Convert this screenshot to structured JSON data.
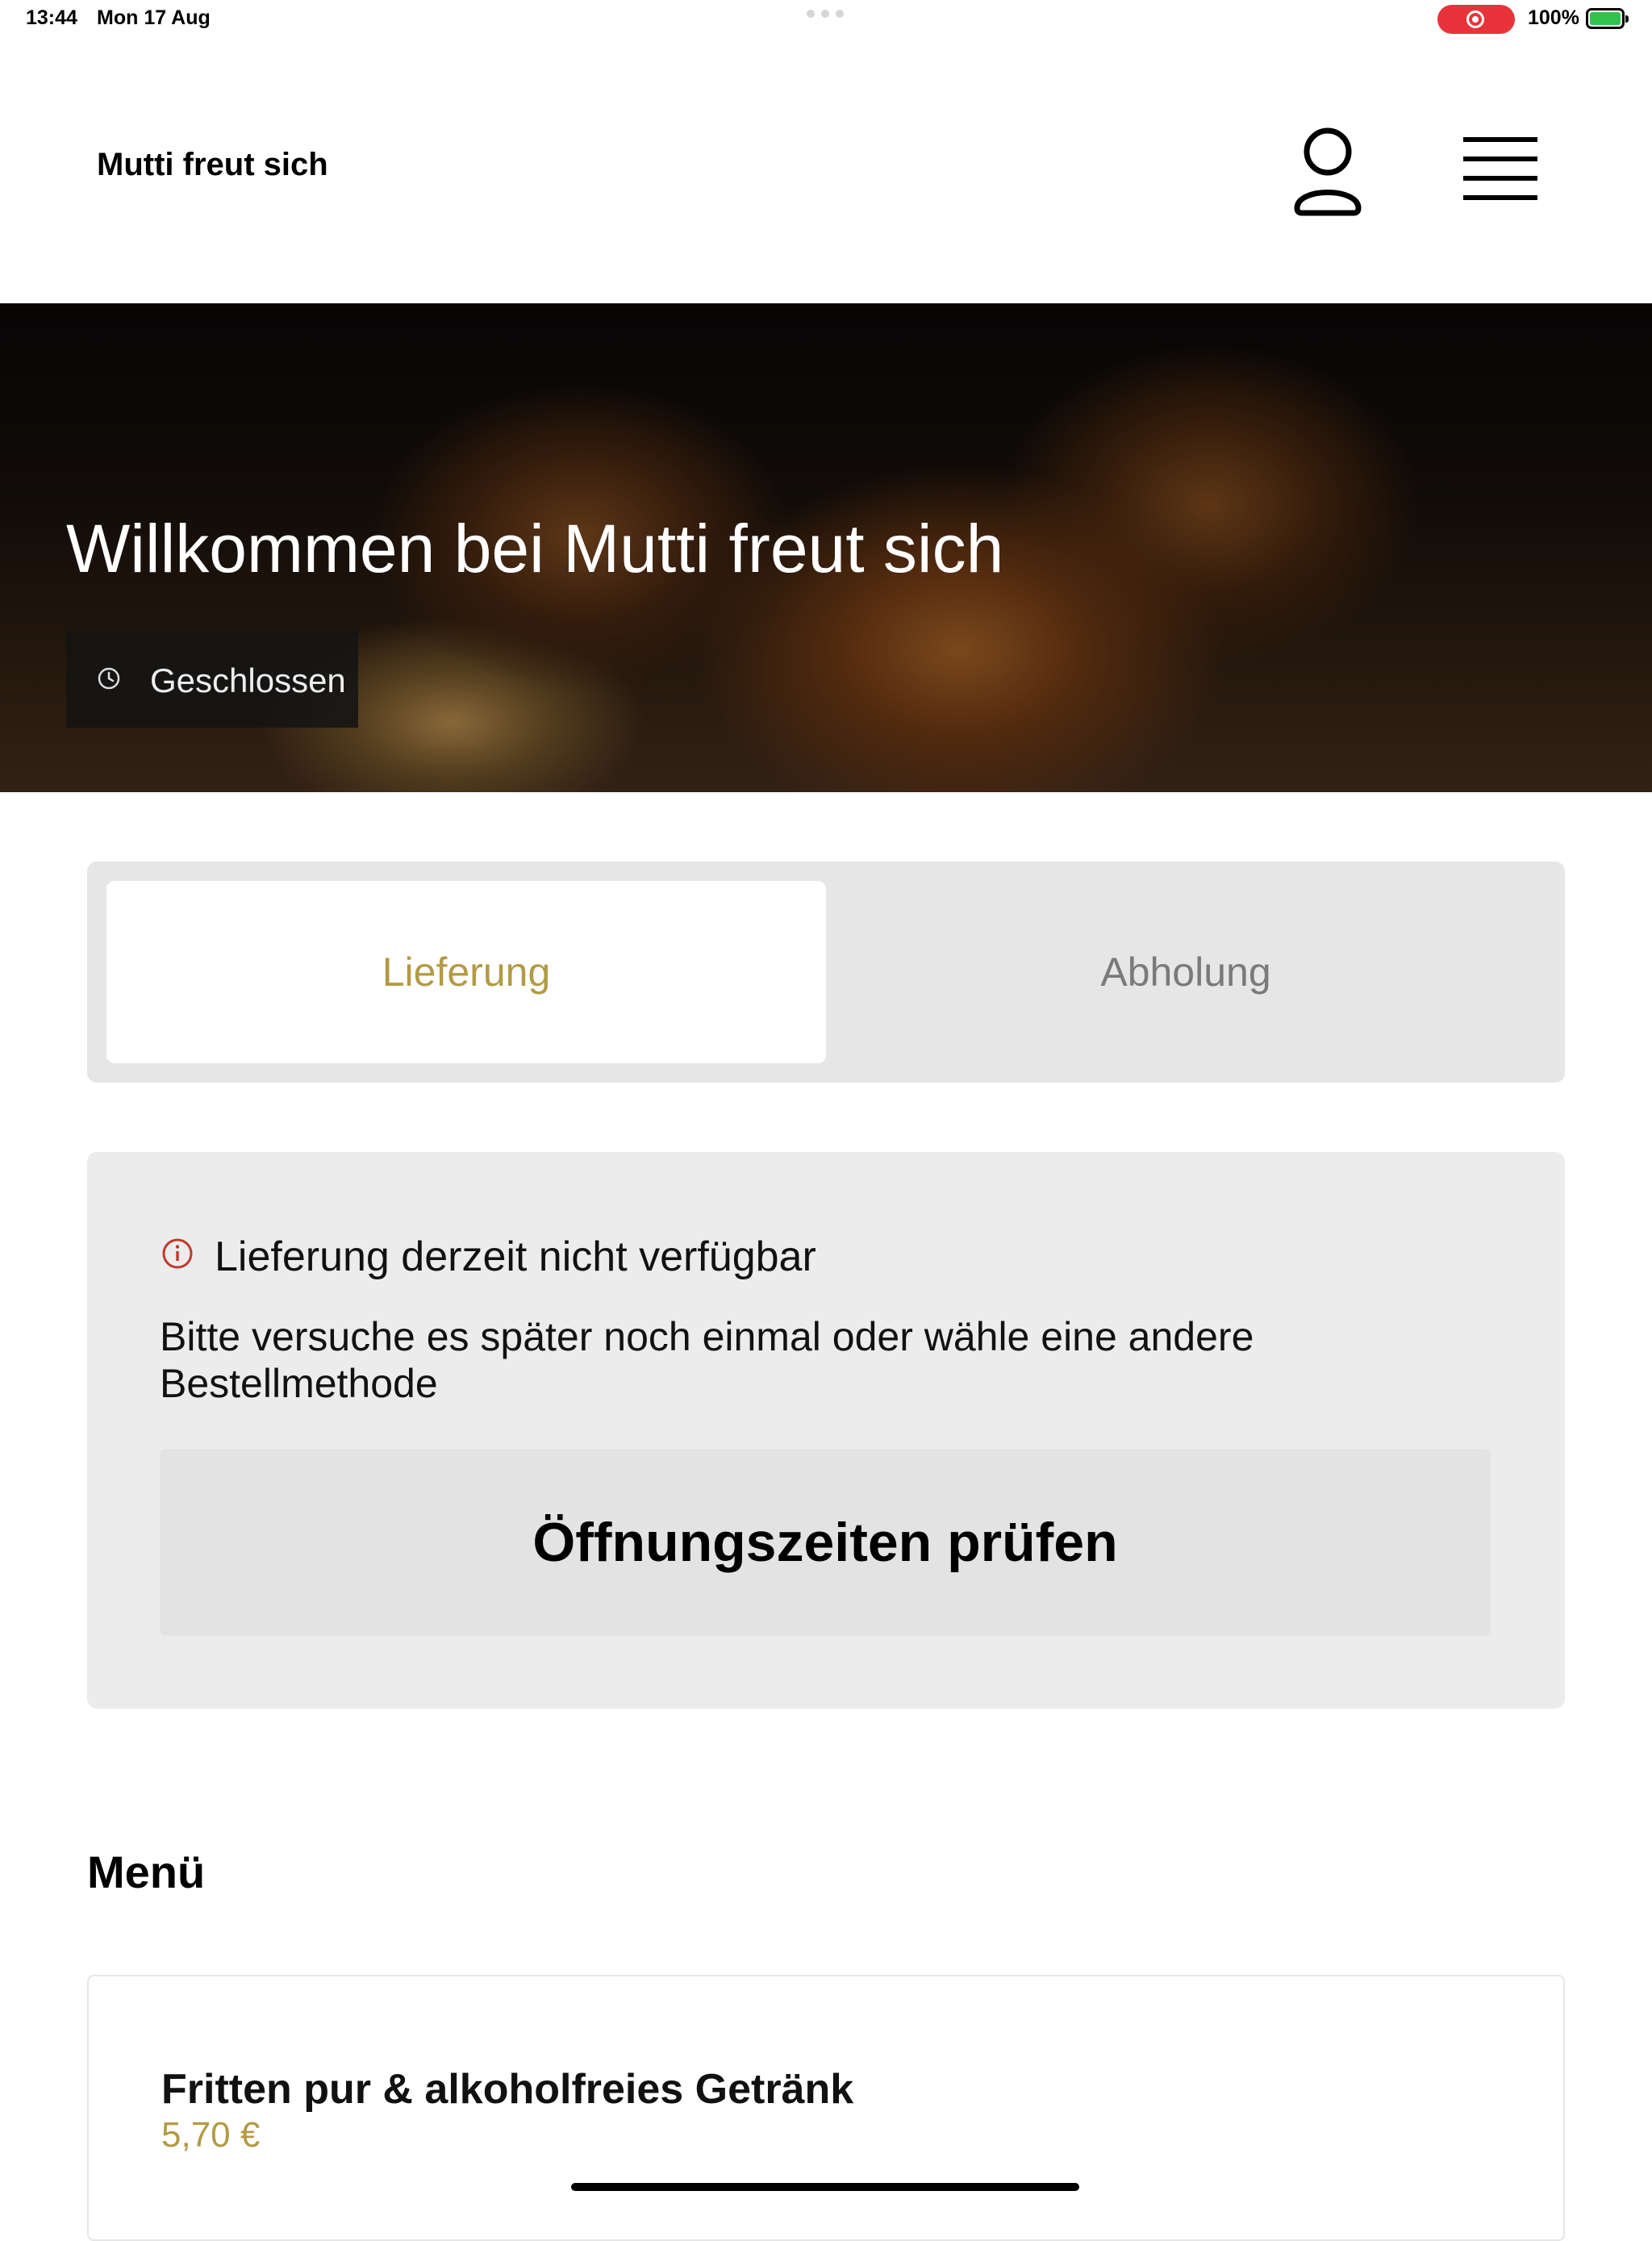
{
  "status_bar": {
    "time": "13:44",
    "date": "Mon 17 Aug",
    "battery": "100%",
    "recording_color": "#e8333a"
  },
  "header": {
    "brand": "Mutti freut sich",
    "icons": [
      "user-icon",
      "hamburger-menu-icon"
    ]
  },
  "hero": {
    "title": "Willkommen bei Mutti freut sich",
    "status": "Geschlossen",
    "status_icon": "clock-icon"
  },
  "order_method": {
    "tabs": [
      {
        "label": "Lieferung",
        "selected": true
      },
      {
        "label": "Abholung",
        "selected": false
      }
    ],
    "accent_color": "#b39a45"
  },
  "notice": {
    "icon": "info-icon",
    "title": "Lieferung derzeit nicht verfügbar",
    "body": "Bitte versuche es später noch einmal oder wähle eine andere Bestellmethode",
    "button": "Öffnungszeiten prüfen",
    "icon_color": "#c0392b"
  },
  "menu": {
    "title": "Menü",
    "items": [
      {
        "name": "Fritten pur & alkoholfreies Getränk",
        "price": "5,70 €"
      }
    ]
  }
}
